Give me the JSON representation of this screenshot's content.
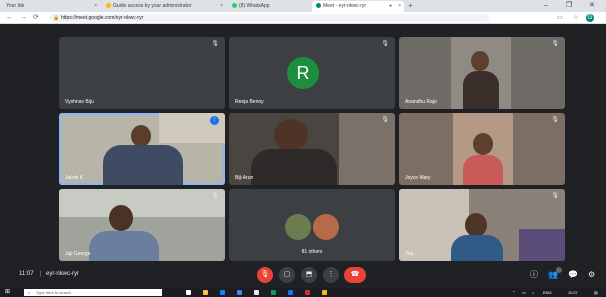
{
  "browser": {
    "tabs": [
      {
        "label": "Your Ide"
      },
      {
        "label": "Guide access by your administrator"
      },
      {
        "label": "(8) WhatsApp"
      },
      {
        "label": "Meet - eyr-nkwc-ryr"
      }
    ],
    "new_tab": "+",
    "url": "https://meet.google.com/eyr-nkwc-ryr"
  },
  "tiles": [
    {
      "name": "Vyshnav Biju"
    },
    {
      "name": "Reeja Benoy",
      "initial": "R",
      "avatar_color": "#1e8e3e"
    },
    {
      "name": "Anandhu Raju"
    },
    {
      "name": "Jacob K"
    },
    {
      "name": "Biji Arun"
    },
    {
      "name": "Joyce Mary"
    },
    {
      "name": "Jaji George"
    },
    {
      "name": "81 others"
    },
    {
      "name": "You"
    }
  ],
  "meeting": {
    "time": "11:07",
    "separator": "|",
    "code": "eyr-nkwc-ryr"
  },
  "taskbar": {
    "search_placeholder": "Type here to search",
    "tray_lang": "ENG",
    "clock": "11:07"
  },
  "colors": {
    "background": "#202124",
    "tile": "#3c4043",
    "speaking_outline": "#8ab4f8",
    "end_call": "#ea4335"
  }
}
